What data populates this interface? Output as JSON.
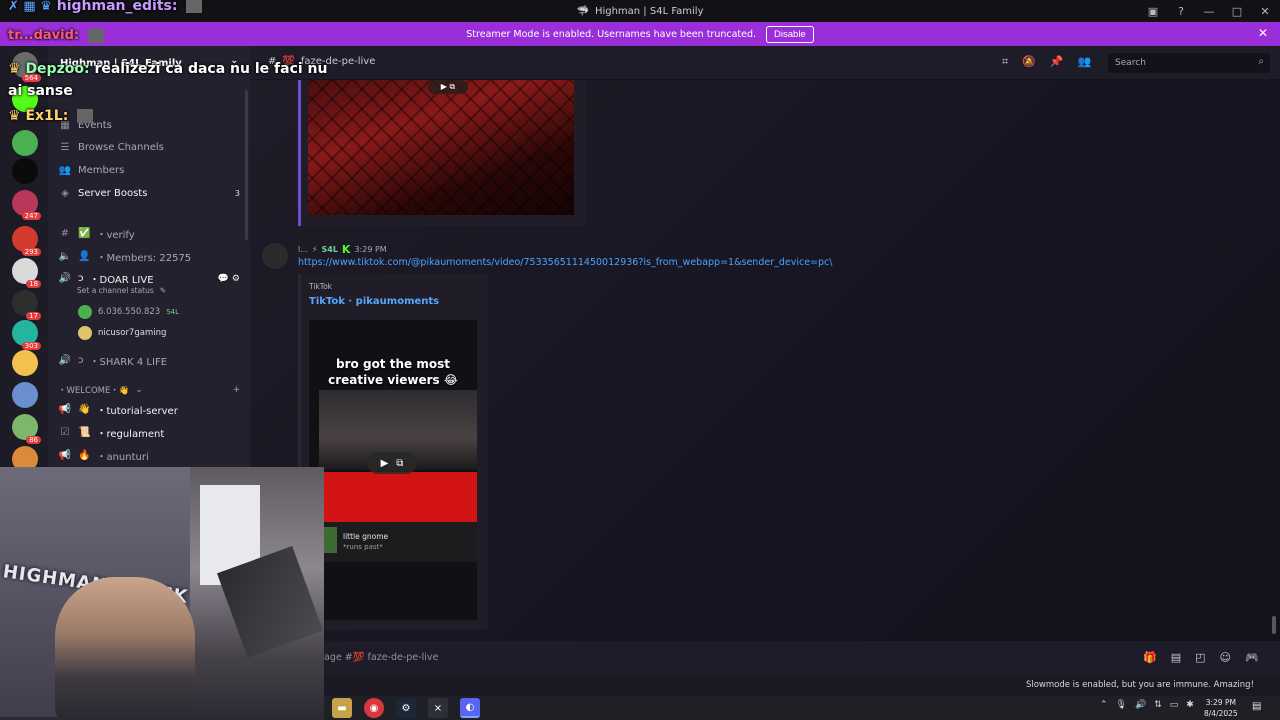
{
  "window": {
    "title": "Highman | S4L Family",
    "streamer_banner": "Streamer Mode is enabled. Usernames have been truncated.",
    "disable_label": "Disable"
  },
  "servers": [
    {
      "badge": "564",
      "color": "#6b6b6b"
    },
    {
      "badge": "",
      "color": "#53fc18"
    },
    {
      "badge": "",
      "color": "#4caf50"
    },
    {
      "badge": "",
      "color": "#0b0b0b"
    },
    {
      "badge": "247",
      "color": "#b8385a"
    },
    {
      "badge": "293",
      "color": "#d33b2e"
    },
    {
      "badge": "18",
      "color": "#d9d9d9"
    },
    {
      "badge": "17",
      "color": "#2e2e2e"
    },
    {
      "badge": "303",
      "color": "#23b5a0"
    },
    {
      "badge": "",
      "color": "#f2c14e"
    },
    {
      "badge": "",
      "color": "#6a8fd1"
    },
    {
      "badge": "86",
      "color": "#7bb76d"
    },
    {
      "badge": "",
      "color": "#d98b3a"
    }
  ],
  "sidebar": {
    "server_name": "Highman | S4L Family",
    "items": {
      "events": "Events",
      "browse": "Browse Channels",
      "members": "Members",
      "boosts": "Server Boosts",
      "boosts_count": "3",
      "verify": "・verify",
      "members_count": "・Members: 22575",
      "doar_live": "・DOAR LIVE",
      "channel_status": "Set a channel status",
      "voice_user1": "6.036.550.823",
      "voice_user1_tag": "S4L",
      "voice_user2": "nicusor7gaming",
      "shark": "・SHARK 4 LIFE",
      "welcome_cat": "・WELCOME・👋",
      "tutorial": "・tutorial-server",
      "regulament": "・regulament",
      "anunturi": "・anunturi"
    }
  },
  "main": {
    "channel_name": "faze-de-pe-live",
    "search_placeholder": "Search",
    "message": {
      "author": "l...",
      "tag": "S4L",
      "time": "3:29 PM",
      "link": "https://www.tiktok.com/@pikaumoments/video/7533565111450012936?is_from_webapp=1&sender_device=pc\\"
    },
    "embed": {
      "provider": "TikTok",
      "title": "TikTok · pikaumoments",
      "caption": "bro got the most creative viewers 😂",
      "card_name": "little gnome",
      "card_sub": "*runs past*"
    },
    "composer_placeholder": "faze-de-pe-live",
    "composer_prefix": "age #💯",
    "slowmode": "Slowmode is enabled, but you are immune. Amazing!"
  },
  "taskbar": {
    "time": "3:29 PM",
    "date": "8/4/2025"
  },
  "overlay_chat": [
    {
      "user": "highman_edits:",
      "text": "",
      "color": "#c79bff"
    },
    {
      "user": "tr...david:",
      "text": "",
      "color": "#ff5a7a"
    },
    {
      "user": "Depzoo:",
      "text": "realizezi ca daca nu le faci nu ai sanse",
      "color": "#9cffb0"
    },
    {
      "user": "Ex1L:",
      "text": "",
      "color": "#ffd36b"
    }
  ],
  "webcam": {
    "poster_text": "HIGHMAN X KICK"
  }
}
